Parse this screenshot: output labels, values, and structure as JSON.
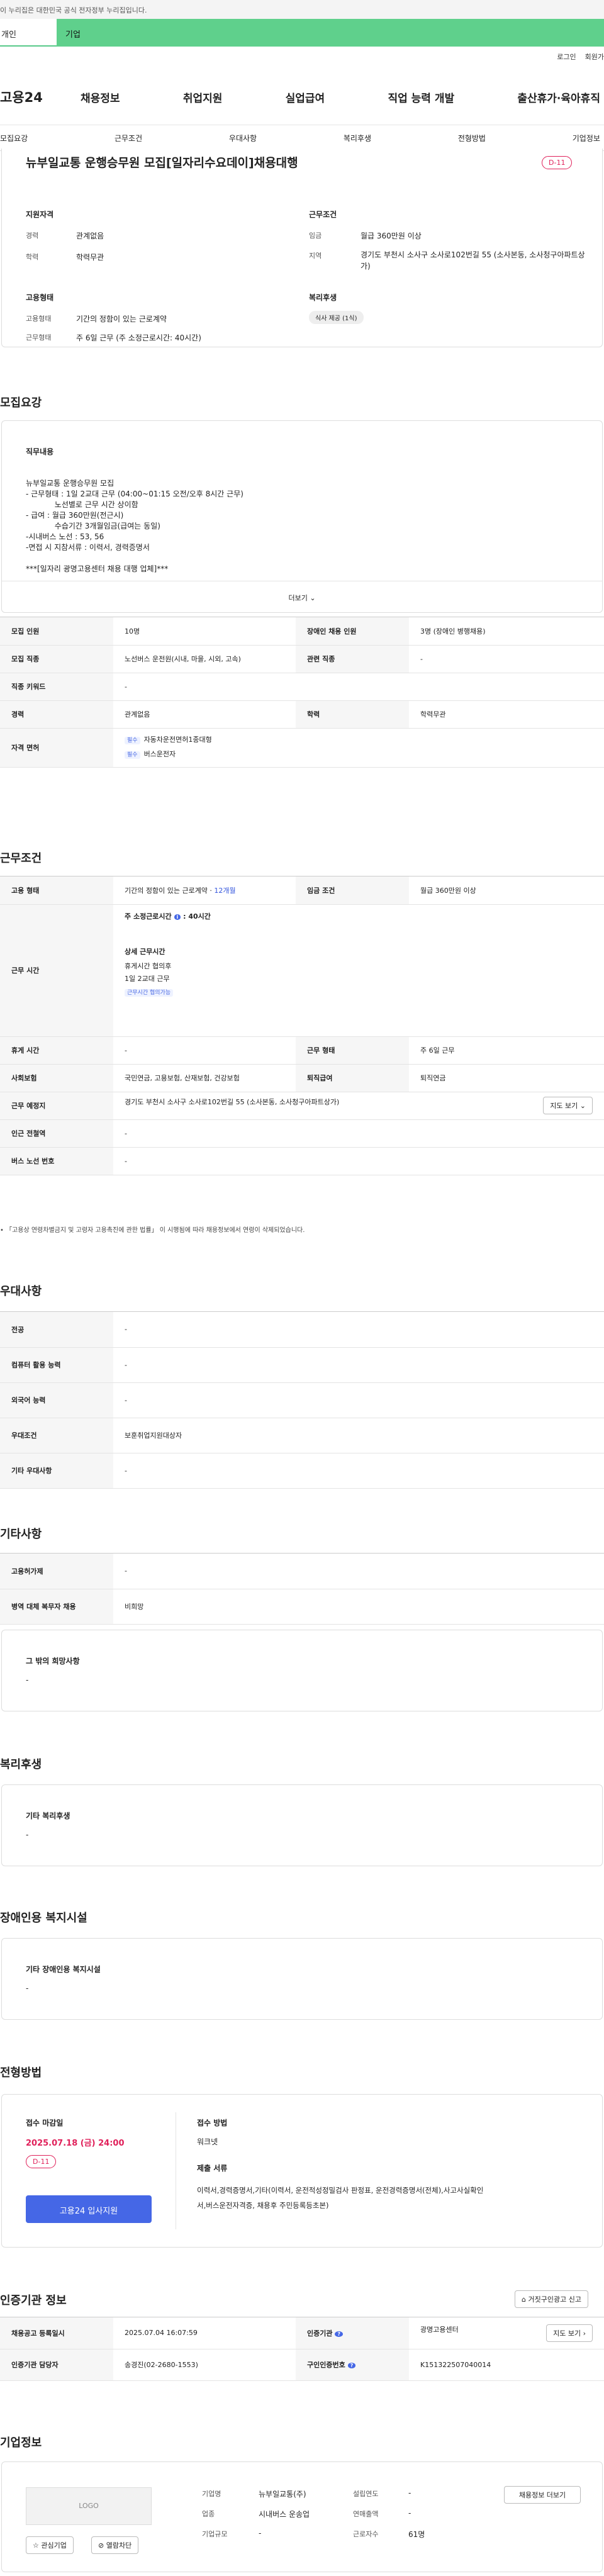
{
  "gov_banner": "이 누리집은 대한민국 공식 전자정부 누리집입니다.",
  "top_tabs": {
    "personal": "개인",
    "company": "기업"
  },
  "util": {
    "login": "로그인",
    "join": "회원가"
  },
  "gnb": {
    "logo": "고용24",
    "items": [
      "채용정보",
      "취업지원",
      "실업급여",
      "직업 능력 개발",
      "출산휴가·육아휴직"
    ]
  },
  "snb": [
    "모집요강",
    "근무조건",
    "우대사항",
    "복리후생",
    "전형방법",
    "기업정보"
  ],
  "job": {
    "title": "뉴부일교통 운행승무원 모집[일자리수요데이]채용대행",
    "dday": "D-11",
    "qual_title": "지원자격",
    "career_label": "경력",
    "career": "관계없음",
    "edu_label": "학력",
    "edu": "학력무관",
    "cond_title": "근무조건",
    "wage_label": "임금",
    "wage": "월급 360만원 이상",
    "loc_label": "지역",
    "loc": "경기도 부천시 소사구 소사로102번길 55 (소사본동, 소사청구아파트상가)",
    "emp_title": "고용형태",
    "emptype_label": "고용형태",
    "emptype": "기간의 정함이 있는 근로계약",
    "worktype_label": "근무형태",
    "worktype": "주 6일 근무 (주 소정근로시간: 40시간)",
    "welfare_title": "복리후생",
    "welfare_chip": "식사 제공 (1식)"
  },
  "recruit": {
    "title": "모집요강",
    "duty_title": "직무내용",
    "duty_lines": [
      "뉴부일교통 운행승무원 모집",
      "- 근무형태 : 1일 2교대 근무 (04:00~01:15 오전/오후 8시간 근무)",
      "            노선별로 근무 시간 상이함",
      "- 급여 : 월급 360만원(전근시)",
      "            수습기간 3개월임금(급여는 동일)",
      "-시내버스 노선 : 53, 56",
      "-면접 시 지참서류 : 이력서, 경력증명서",
      "",
      "***[일자리 광명고용센터 채용 대행 업체]***"
    ],
    "more": "더보기",
    "rows": [
      [
        "모집 인원",
        "10명",
        "장애인 채용 인원",
        "3명 (장애인 병행채용)"
      ],
      [
        "모집 직종",
        "노선버스 운전원(시내, 마을, 시외, 고속)",
        "관련 직종",
        "-"
      ],
      [
        "직종 키워드",
        "-"
      ],
      [
        "경력",
        "관계없음",
        "학력",
        "학력무관"
      ]
    ],
    "license_label": "자격 면허",
    "licenses": [
      {
        "tag": "필수",
        "name": "자동차운전면허1종대형"
      },
      {
        "tag": "필수",
        "name": "버스운전자"
      }
    ]
  },
  "work": {
    "title": "근무조건",
    "emp_label": "고용 형태",
    "emp_value": "기간의 정함이 있는 근로계약 · ",
    "emp_months": "12개월",
    "wage_label": "임금 조건",
    "wage_value": "월급 360만원 이상",
    "hours_label": "근무 시간",
    "hours_head": "주 소정근로시간",
    "hours_num": "40시간",
    "detail_title": "상세 근무시간",
    "detail_lines": [
      "휴게시간 협의후",
      "1일 2교대 근무"
    ],
    "detail_chip": "근무시간 협의가능",
    "rest_label": "휴게 시간",
    "rest_value": "-",
    "type_label": "근무 형태",
    "type_value": "주 6일 근무",
    "ins_label": "사회보험",
    "ins_value": "국민연금, 고용보험, 산재보험, 건강보험",
    "retire_label": "퇴직급여",
    "retire_value": "퇴직연금",
    "place_label": "근무 예정지",
    "place_value": "경기도 부천시 소사구 소사로102번길 55 (소사본동, 소사청구아파트상가)",
    "map_btn": "지도 보기",
    "subway_label": "인근 전철역",
    "subway_value": "-",
    "bus_label": "버스 노선 번호",
    "bus_value": "-",
    "notice": "「고용상 연령차별금지 및 고령자 고용촉진에 관한 법률」 이 시행됨에 따라 채용정보에서 연령이 삭제되었습니다."
  },
  "prefer": {
    "title": "우대사항",
    "rows": [
      [
        "전공",
        "-"
      ],
      [
        "컴퓨터 활용 능력",
        "-"
      ],
      [
        "외국어 능력",
        "-"
      ],
      [
        "우대조건",
        "보훈취업지원대상자"
      ],
      [
        "기타 우대사항",
        "-"
      ]
    ]
  },
  "etc": {
    "title": "기타사항",
    "rows": [
      [
        "고용허가제",
        "-"
      ],
      [
        "병역 대체 복무자 채용",
        "비희망"
      ]
    ],
    "other_title": "그 밖의 희망사항",
    "other_value": "-"
  },
  "welfare": {
    "title": "복리후생",
    "box_title": "기타 복리후생",
    "box_value": "-"
  },
  "disabled": {
    "title": "장애인용 복지시설",
    "box_title": "기타 장애인용 복지시설",
    "box_value": "-"
  },
  "selection": {
    "title": "전형방법",
    "deadline_title": "접수 마감일",
    "deadline": "2025.07.18 (금) 24:00",
    "dday": "D-11",
    "apply_btn": "고용24 입사지원",
    "method_title": "접수 방법",
    "method": "워크넷",
    "docs_title": "제출 서류",
    "docs_lines": [
      "이력서,경력증명서,기타(이력서, 운전적성정밀검사 판정표, 운전경력증명서(전체),사고사실확인",
      "서,버스운전자격증, 채용후 주민등록등초본)"
    ]
  },
  "agency": {
    "title": "인증기관 정보",
    "report_btn": "거짓구인광고 신고",
    "reg_label": "채용공고 등록일시",
    "reg_value": "2025.07.04 16:07:59",
    "org_label": "인증기관",
    "org_value": "광명고용센터",
    "map_btn": "지도 보기",
    "manager_label": "인증기관 담당자",
    "manager_value": "송경진(02-2680-1553)",
    "id_label": "구인인증번호",
    "id_value": "K151322507040014"
  },
  "company": {
    "title": "기업정보",
    "logo": "LOGO",
    "fav": "관심기업",
    "block": "열람차단",
    "more_btn": "채용정보 더보기",
    "name_label": "기업명",
    "name": "뉴부일교통(주)",
    "est_label": "설립연도",
    "est": "-",
    "ind_label": "업종",
    "ind": "시내버스 운송업",
    "sales_label": "연매출액",
    "sales": "-",
    "size_label": "기업규모",
    "size": "-",
    "emp_label": "근로자수",
    "emp": "61명"
  }
}
